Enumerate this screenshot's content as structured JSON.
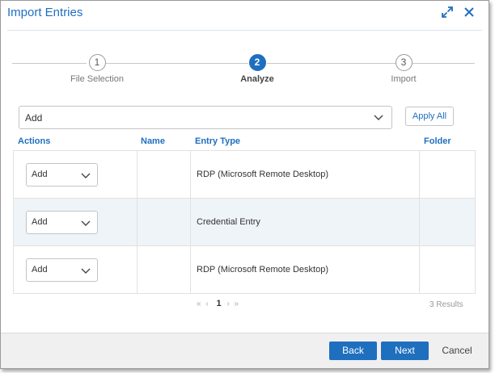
{
  "dialog": {
    "title": "Import Entries",
    "expand_icon": "expand-icon",
    "close_icon": "close-icon"
  },
  "steps": [
    {
      "number": "1",
      "label": "File Selection",
      "active": false
    },
    {
      "number": "2",
      "label": "Analyze",
      "active": true
    },
    {
      "number": "3",
      "label": "Import",
      "active": false
    }
  ],
  "action_select": {
    "value": "Add"
  },
  "apply_all_label": "Apply All",
  "table": {
    "headers": {
      "actions": "Actions",
      "name": "Name",
      "entry_type": "Entry Type",
      "folder": "Folder"
    },
    "rows": [
      {
        "action": "Add",
        "name": "",
        "entry_type": "RDP (Microsoft Remote Desktop)",
        "folder": ""
      },
      {
        "action": "Add",
        "name": "",
        "entry_type": "Credential Entry",
        "folder": ""
      },
      {
        "action": "Add",
        "name": "",
        "entry_type": "RDP (Microsoft Remote Desktop)",
        "folder": ""
      }
    ]
  },
  "pagination": {
    "first": "«",
    "prev": "‹",
    "current": "1",
    "next": "›",
    "last": "»",
    "results": "3 Results"
  },
  "footer": {
    "back": "Back",
    "next": "Next",
    "cancel": "Cancel"
  },
  "colors": {
    "accent": "#1f6fbf",
    "alt_row": "#eff4f9",
    "footer_bg": "#f0f0f0"
  }
}
